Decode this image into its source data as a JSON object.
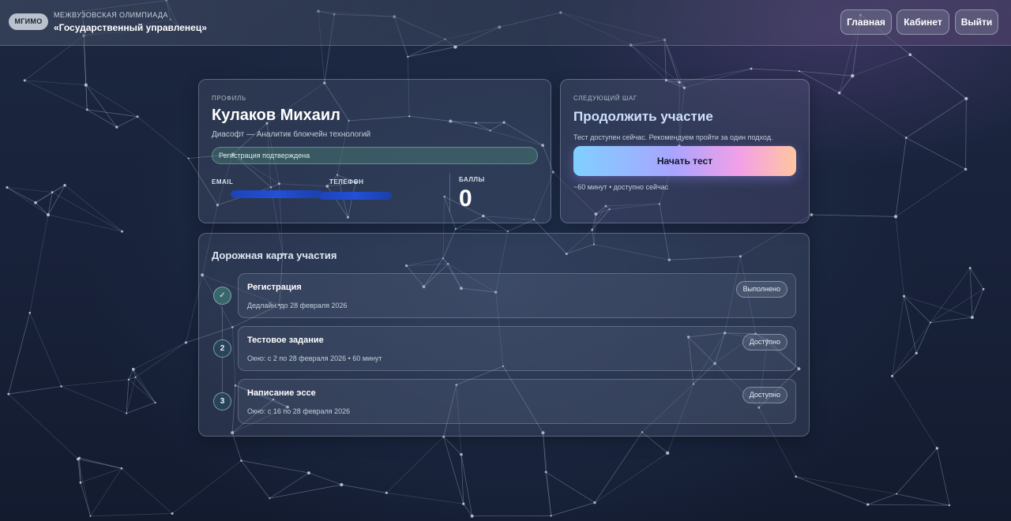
{
  "header": {
    "logo_text": "МГИМО",
    "subtitle": "МЕЖВУЗОВСКАЯ ОЛИМПИАДА",
    "title": "«Государственный управленец»",
    "nav": {
      "home": "Главная",
      "cabinet": "Кабинет",
      "logout": "Выйти"
    }
  },
  "profile": {
    "section_label": "ПРОФИЛЬ",
    "name": "Кулаков Михаил",
    "role": "Диасофт — Аналитик блокчейн технологий",
    "registration_status": "Регистрация подтверждена",
    "email_label": "EMAIL",
    "phone_label": "ТЕЛЕФОН",
    "score_label": "БАЛЛЫ",
    "score_value": "0"
  },
  "next_step": {
    "section_label": "СЛЕДУЮЩИЙ ШАГ",
    "title": "Продолжить участие",
    "description": "Тест доступен сейчас. Рекомендуем пройти за один подход.",
    "button_label": "Начать тест",
    "meta": "~60 минут • доступно сейчас"
  },
  "roadmap": {
    "title": "Дорожная карта участия",
    "steps": [
      {
        "marker": "✓",
        "title": "Регистрация",
        "meta": "Дедлайн: до 28 февраля 2026",
        "badge": "Выполнено"
      },
      {
        "marker": "2",
        "title": "Тестовое задание",
        "meta": "Окно: с 2 по 28 февраля 2026 • 60 минут",
        "badge": "Доступно"
      },
      {
        "marker": "3",
        "title": "Написание эссе",
        "meta": "Окно: с 16 по 28 февраля 2026",
        "badge": "Доступно"
      }
    ]
  },
  "colors": {
    "background": "#18223a",
    "accent_gradient_start": "#7fd0ff",
    "accent_gradient_end": "#ffc6a0",
    "status_green": "#5aa893",
    "redaction_blue": "#2250d6"
  }
}
